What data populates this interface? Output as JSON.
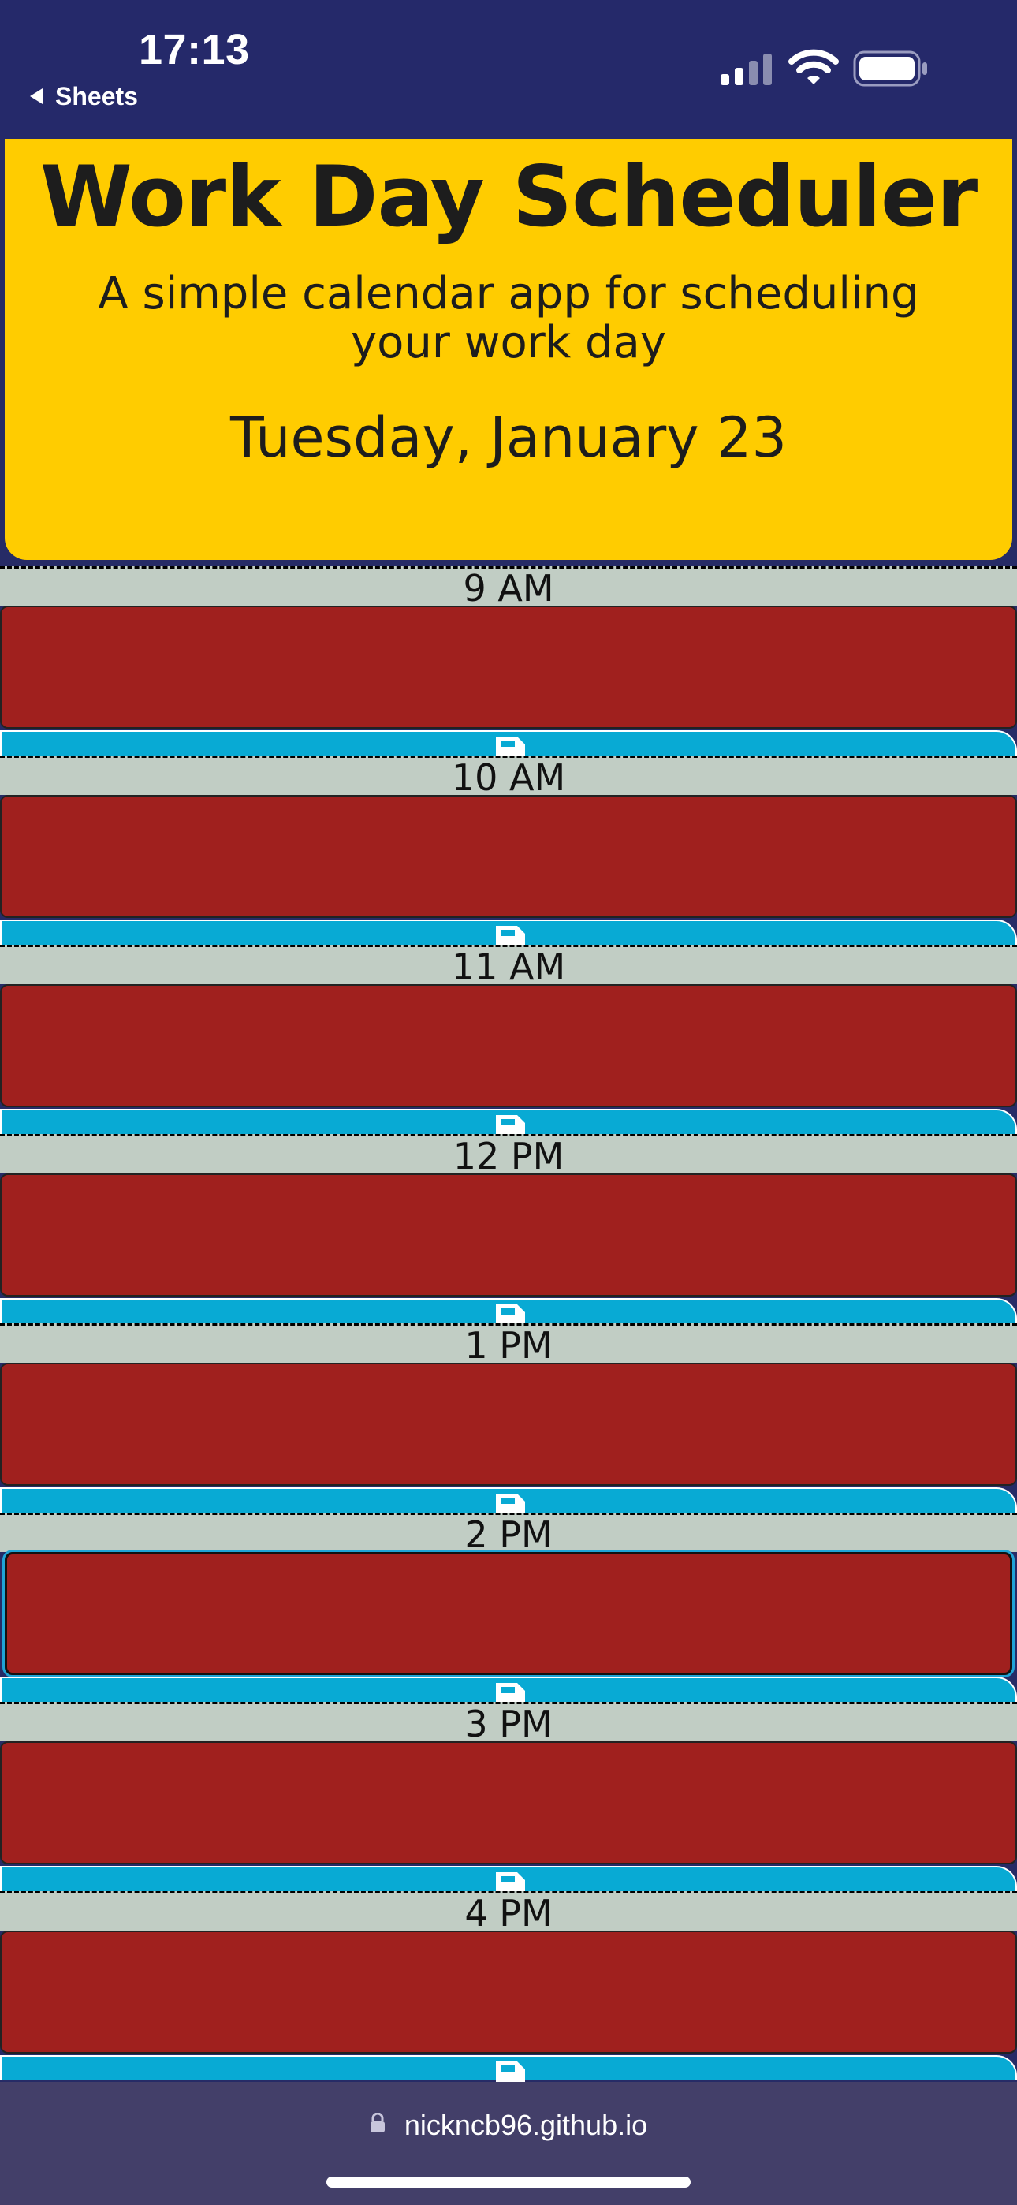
{
  "status_bar": {
    "time": "17:13",
    "back_label": "Sheets"
  },
  "header": {
    "title": "Work Day Scheduler",
    "subtitle": "A simple calendar app for scheduling your work day",
    "current_day": "Tuesday, January 23"
  },
  "hours": [
    {
      "label": "9 AM",
      "value": "",
      "state": "past"
    },
    {
      "label": "10 AM",
      "value": "",
      "state": "past"
    },
    {
      "label": "11 AM",
      "value": "",
      "state": "past"
    },
    {
      "label": "12 PM",
      "value": "",
      "state": "past"
    },
    {
      "label": "1 PM",
      "value": "",
      "state": "past"
    },
    {
      "label": "2 PM",
      "value": "",
      "state": "past"
    },
    {
      "label": "3 PM",
      "value": "",
      "state": "past"
    },
    {
      "label": "4 PM",
      "value": "",
      "state": "past"
    }
  ],
  "browser": {
    "url": "nickncb96.github.io"
  },
  "colors": {
    "header_bg": "#ffcc00",
    "hour_label_bg": "#c1cdc4",
    "past_bg": "#a0201e",
    "save_bg": "#08aad4",
    "page_bg": "#262b66"
  },
  "icons": {
    "save": "save-icon",
    "lock": "lock-icon",
    "signal": "signal-icon",
    "wifi": "wifi-icon",
    "battery": "battery-icon"
  }
}
